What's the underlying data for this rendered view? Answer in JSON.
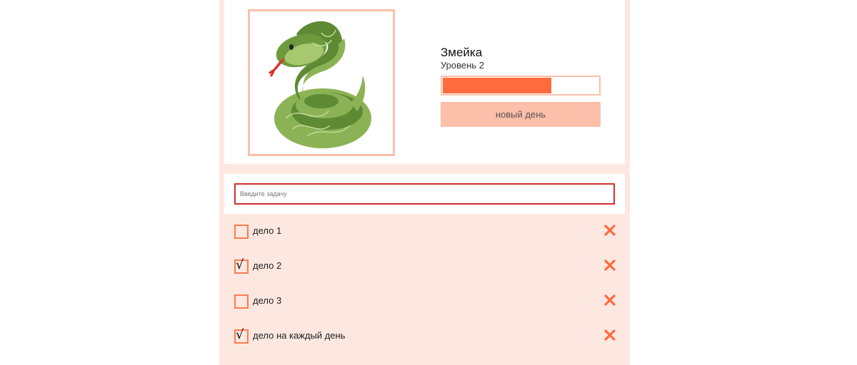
{
  "pet": {
    "name": "Змейка",
    "level": "Уровень 2",
    "progress": 0.7,
    "new_day_label": "новый день",
    "image_icon": "snake-illustration"
  },
  "task_input": {
    "placeholder": "Введите задачу",
    "value": ""
  },
  "tasks": [
    {
      "label": "дело 1",
      "done": false
    },
    {
      "label": "дело 2",
      "done": true
    },
    {
      "label": "дело 3",
      "done": false
    },
    {
      "label": "дело на каждый день",
      "done": true
    }
  ],
  "colors": {
    "accent": "#ff6b3d",
    "accent_light": "#fbbfaa",
    "background": "#fde8e1",
    "input_border": "#d1312f"
  },
  "icons": {
    "delete": "close-icon",
    "checkbox": "checkbox-icon"
  }
}
